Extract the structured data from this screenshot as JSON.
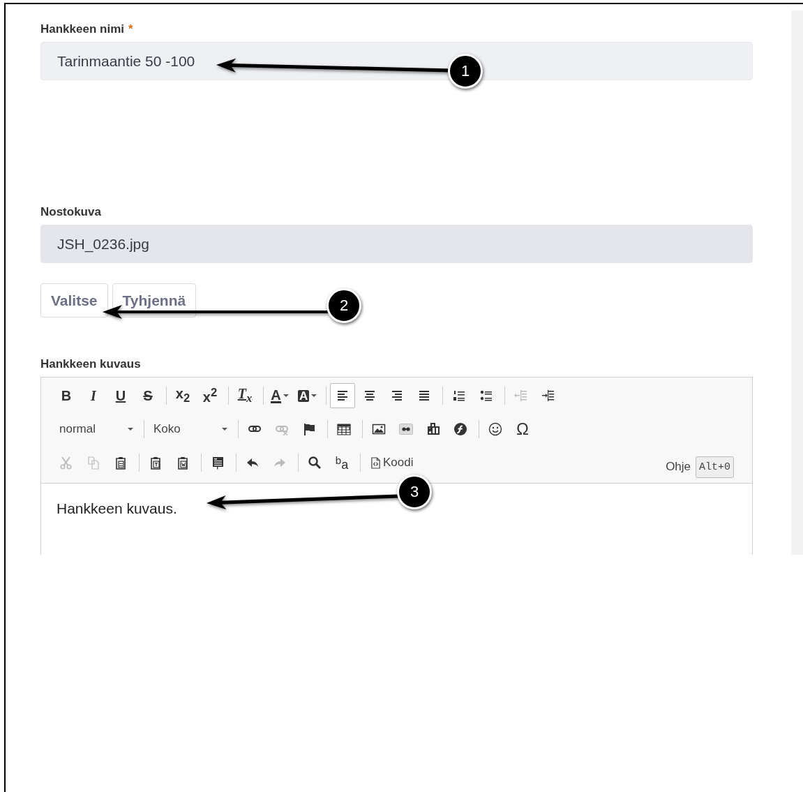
{
  "name_field": {
    "label": "Hankkeen nimi",
    "required_mark": "*",
    "value": "Tarinmaantie 50 -100"
  },
  "image_field": {
    "label": "Nostokuva",
    "value": "JSH_0236.jpg",
    "buttons": [
      "Valitse",
      "Tyhjennä"
    ]
  },
  "description_editor": {
    "label": "Hankkeen kuvaus",
    "toolbar": [
      [
        [
          {
            "kind": "bold",
            "glyph": "B",
            "disabled": false
          },
          {
            "kind": "italic",
            "glyph": "I",
            "disabled": false
          },
          {
            "kind": "underline",
            "glyph": "U",
            "disabled": false
          },
          {
            "kind": "strike",
            "glyph": "S",
            "disabled": false
          }
        ],
        [
          {
            "kind": "subscript",
            "glyph": "x$_{2}$",
            "disabled": false
          },
          {
            "kind": "superscript",
            "glyph": "x$^{2}$",
            "disabled": false
          }
        ],
        [
          {
            "kind": "remove-format",
            "glyph": "T$_{x}$",
            "disabled": false
          }
        ],
        [
          {
            "kind": "text-color",
            "glyph": "A",
            "disabled": false
          },
          {
            "kind": "bg-color",
            "glyph": "A",
            "disabled": false
          }
        ],
        [
          {
            "kind": "align-left",
            "selected": true,
            "disabled": false
          },
          {
            "kind": "align-center",
            "selected": false,
            "disabled": false
          },
          {
            "kind": "align-right",
            "selected": false,
            "disabled": false
          },
          {
            "kind": "justify",
            "selected": false,
            "disabled": false
          }
        ],
        [
          {
            "kind": "numbered-list",
            "disabled": false
          },
          {
            "kind": "bullet-list",
            "disabled": false
          }
        ],
        [
          {
            "kind": "outdent",
            "disabled": true
          },
          {
            "kind": "indent",
            "disabled": false
          }
        ]
      ],
      [
        [
          {
            "kind": "dropdown",
            "value": "normal"
          }
        ],
        [
          {
            "kind": "dropdown",
            "value": "Koko"
          }
        ],
        [
          {
            "kind": "link",
            "disabled": false
          },
          {
            "kind": "unlink",
            "disabled": true
          },
          {
            "kind": "anchor",
            "disabled": false
          }
        ],
        [
          {
            "kind": "table",
            "disabled": false
          }
        ],
        [
          {
            "kind": "image",
            "disabled": false
          },
          {
            "kind": "iframe",
            "disabled": false
          },
          {
            "kind": "media",
            "disabled": false
          },
          {
            "kind": "flash",
            "disabled": false
          }
        ],
        [
          {
            "kind": "smiley",
            "disabled": false
          },
          {
            "kind": "special-char",
            "glyph": "Ω",
            "disabled": false
          }
        ]
      ],
      [
        [
          {
            "kind": "cut",
            "disabled": true
          },
          {
            "kind": "copy",
            "disabled": true
          },
          {
            "kind": "paste",
            "disabled": false
          }
        ],
        [
          {
            "kind": "paste-text",
            "disabled": false
          },
          {
            "kind": "paste-word",
            "disabled": false
          }
        ],
        [
          {
            "kind": "template",
            "disabled": false
          }
        ],
        [
          {
            "kind": "undo",
            "disabled": false
          },
          {
            "kind": "redo",
            "disabled": true
          }
        ],
        [
          {
            "kind": "find",
            "disabled": false
          },
          {
            "kind": "replace",
            "glyph": "$^{b}$a",
            "disabled": false
          }
        ],
        [
          {
            "kind": "source",
            "label": "Koodi",
            "disabled": false
          }
        ]
      ]
    ],
    "help": {
      "label": "Ohje",
      "shortcut": "Alt+0"
    },
    "content": "Hankkeen kuvaus."
  },
  "callouts": [
    {
      "number": "1"
    },
    {
      "number": "2"
    },
    {
      "number": "3"
    }
  ]
}
